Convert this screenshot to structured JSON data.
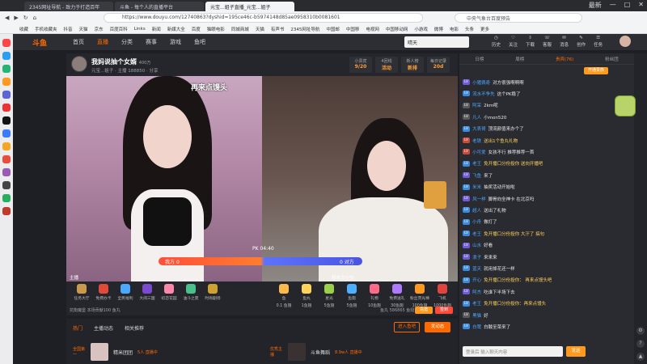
{
  "browser": {
    "tabs": [
      "2345网址导航 - 致力于打造百年",
      "斗鱼 - 每个人的直播平台",
      "元宝...姐子直播_元宝...姐子"
    ],
    "window_controls": [
      "最新",
      "—",
      "□",
      "✕"
    ],
    "url": "https://www.douyu.com/12740863?dyshid=195ce46c-b5974148d85ae0958310b0081601",
    "search": "中央气象台百度预告",
    "bookmarks": [
      "收藏",
      "手机收藏夹",
      "抖音",
      "天猫",
      "京东",
      "百度百科",
      "Links",
      "新闻",
      "新媒大全",
      "百度",
      "猫眼电影",
      "同城商城",
      "天猫",
      "有声书",
      "2345网址导航",
      "中国邮",
      "中国移",
      "电视网",
      "中国移动网",
      "小游戏",
      "微博",
      "电影",
      "头条",
      "更多"
    ]
  },
  "site": {
    "logo": "斗鱼",
    "nav": [
      "首页",
      "直播",
      "分类",
      "赛事",
      "游戏",
      "鱼吧"
    ],
    "nav_active": "直播",
    "search_text": "晴天",
    "header_icons": [
      "历史",
      "关注",
      "下载",
      "客服",
      "消息",
      "创作",
      "任务"
    ]
  },
  "room": {
    "title": "我妈说抽个女婿",
    "follow_count": "400万",
    "sub_line": "元宝...姐子 · 主播 188850 · 分享",
    "stats": [
      {
        "label": "小贵宾",
        "value": "9/20"
      },
      {
        "label": "4回线",
        "value": "活动"
      },
      {
        "label": "新人榜",
        "value": "新排"
      },
      {
        "label": "每日记录",
        "value": "20d"
      }
    ],
    "overlay_text": "再来点馒头",
    "pk": {
      "left_name": "我方",
      "left_score": "0",
      "right_name": "对方",
      "right_score": "0",
      "time": "PK 04:40"
    },
    "cam_left_label": "主播",
    "cam_right_label": "精米文小包"
  },
  "gifts_left": [
    "任务大厅",
    "免费办卡",
    "全民福利",
    "大闹三国",
    "初恋花园",
    "油斗之夏",
    "时尚剧场"
  ],
  "gifts_right": [
    "鱼",
    "鱼丸",
    "星光",
    "鱼翅",
    "礼物",
    "免费送礼",
    "粉丝荧光棒",
    "飞机"
  ],
  "gift_sub": [
    "0.1 鱼翅",
    "1鱼翅",
    "5鱼翅",
    "5鱼翅",
    "10鱼翅",
    "30鱼翅",
    "100鱼翅",
    "1000鱼翅"
  ],
  "bottom_info": {
    "rank_line": "抗衡魔堡 本场贡献100 鱼丸",
    "fish_label": "鱼丸 586865",
    "fishfin_label": "鱼翅 0.53",
    "btn_charge": "充值",
    "btn_sign": "签到"
  },
  "lower": {
    "tabs": [
      "热门",
      "主播动态",
      "相关推荐"
    ],
    "tab_active": "热门",
    "btn1": "进入鱼吧",
    "btn2": "发动态",
    "cards": [
      {
        "tag": "全国第一",
        "name": "精米团团",
        "meta": "5人 直播中"
      },
      {
        "tag": "优秀主播",
        "name": "斗鱼舞蹈",
        "meta": "8.9w人 直播中"
      }
    ]
  },
  "chat": {
    "tabs": [
      "日榜",
      "周榜",
      "贵宾(76)",
      "粉丝团"
    ],
    "tab_active": "贵宾(76)",
    "noble_btn": "开通贵族",
    "messages": [
      {
        "level": "LV",
        "name": "小猪佩奇",
        "text": "对方很强啊啊啊",
        "kind": "normal",
        "badge_color": "#6f5bd6"
      },
      {
        "level": "LV",
        "name": "流水不争先",
        "text": "这个PK稳了",
        "kind": "normal",
        "badge_color": "#3a8be0"
      },
      {
        "level": "LV",
        "name": "阿呆",
        "text": "2km呢",
        "kind": "normal",
        "badge_color": "#5a5a5a"
      },
      {
        "level": "LV",
        "name": "凡人",
        "text": "小mon520",
        "kind": "normal",
        "badge_color": "#5a5a5a"
      },
      {
        "level": "LV",
        "name": "大表哥",
        "text": "顶流颜值来办个了",
        "kind": "normal",
        "badge_color": "#3a8be0"
      },
      {
        "level": "LV",
        "name": "老铁",
        "text": "送出1个鱼丸礼物",
        "kind": "sys",
        "badge_color": "#c84a3a"
      },
      {
        "level": "LV",
        "name": "小可爱",
        "text": "女孩不行  推荐推荐一首",
        "kind": "normal",
        "badge_color": "#c84a3a"
      },
      {
        "level": "LV",
        "name": "老王",
        "text": "免开播口分份投你 送向开播吧",
        "kind": "sys",
        "badge_color": "#3a8be0"
      },
      {
        "level": "LV",
        "name": "飞鱼",
        "text": "来了",
        "kind": "normal",
        "badge_color": "#6f5bd6"
      },
      {
        "level": "LV",
        "name": "米米",
        "text": "抽奖活动开始啦",
        "kind": "normal",
        "badge_color": "#3a8be0"
      },
      {
        "level": "LV",
        "name": "风一样",
        "text": "脚骨向全神卡  在北京吗",
        "kind": "normal",
        "badge_color": "#6f5bd6"
      },
      {
        "level": "LV",
        "name": "超人",
        "text": "送出了礼物",
        "kind": "normal",
        "badge_color": "#3a8be0"
      },
      {
        "level": "LV",
        "name": "小舟",
        "text": "做灯了",
        "kind": "normal",
        "badge_color": "#3a8be0"
      },
      {
        "level": "LV",
        "name": "老王",
        "text": "免开播口分份投你 大汗了  搞句",
        "kind": "sys",
        "badge_color": "#3a8be0"
      },
      {
        "level": "LV",
        "name": "山水",
        "text": "好看",
        "kind": "normal",
        "badge_color": "#6f5bd6"
      },
      {
        "level": "LV",
        "name": "浪子",
        "text": "来来来",
        "kind": "normal",
        "badge_color": "#6f5bd6"
      },
      {
        "level": "LV",
        "name": "蓝天",
        "text": "就用掉花还一样",
        "kind": "normal",
        "badge_color": "#3a8be0"
      },
      {
        "level": "LV",
        "name": "开心",
        "text": "免开播口分份投你：  再来点馒头吧",
        "kind": "sys",
        "badge_color": "#3a8be0"
      },
      {
        "level": "LV",
        "name": "阿杰",
        "text": "吃谁下半场下去",
        "kind": "normal",
        "badge_color": "#6f5bd6"
      },
      {
        "level": "LV",
        "name": "老王",
        "text": "免开播口分份投你：再来点馒头",
        "kind": "sys",
        "badge_color": "#3a8be0"
      },
      {
        "level": "LV",
        "name": "黑猫",
        "text": "好",
        "kind": "normal",
        "badge_color": "#5a5a5a"
      },
      {
        "level": "LV",
        "name": "白鹭",
        "text": "白酸至菜来了",
        "kind": "normal",
        "badge_color": "#3a8be0"
      }
    ],
    "input_placeholder": "登录后 输入聊天内容",
    "send": "发送"
  },
  "colors": {
    "accent": "#ff6a00",
    "pk_red": "#ff4e3a",
    "pk_blue": "#4a55e0"
  }
}
